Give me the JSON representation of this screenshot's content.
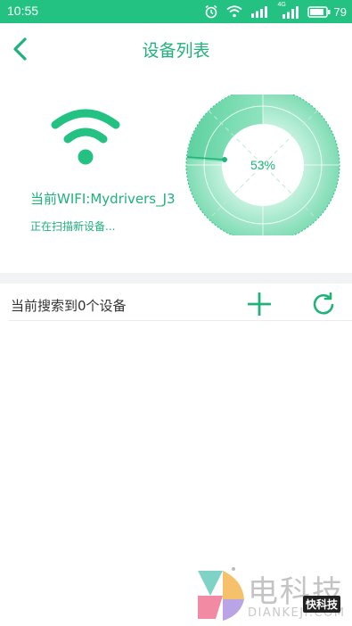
{
  "status_bar": {
    "time": "10:55",
    "battery_percent": "79",
    "signal_2_label": "4G",
    "icons": [
      "alarm-icon",
      "wifi-icon",
      "signal-icon",
      "signal-icon",
      "battery-icon"
    ],
    "background_color": "#23c283"
  },
  "header": {
    "back_icon": "chevron-left-icon",
    "title": "设备列表"
  },
  "wifi_panel": {
    "icon": "wifi-icon",
    "current_wifi": "当前WIFI:Mydrivers_J3",
    "scan_status": "正在扫描新设备..."
  },
  "radar": {
    "progress_text": "53%",
    "progress_percent": 53,
    "accent_color": "#23c283"
  },
  "device_list": {
    "count_text": "当前搜索到0个设备",
    "add_icon": "plus-icon",
    "refresh_icon": "refresh-icon",
    "items": []
  },
  "watermark": {
    "cn_text": "电科技",
    "en_text": "DIANKEJI.COM",
    "badge_text": "快科技"
  },
  "colors": {
    "accent": "#1fb27a",
    "light_accent": "#a9ebd0"
  }
}
